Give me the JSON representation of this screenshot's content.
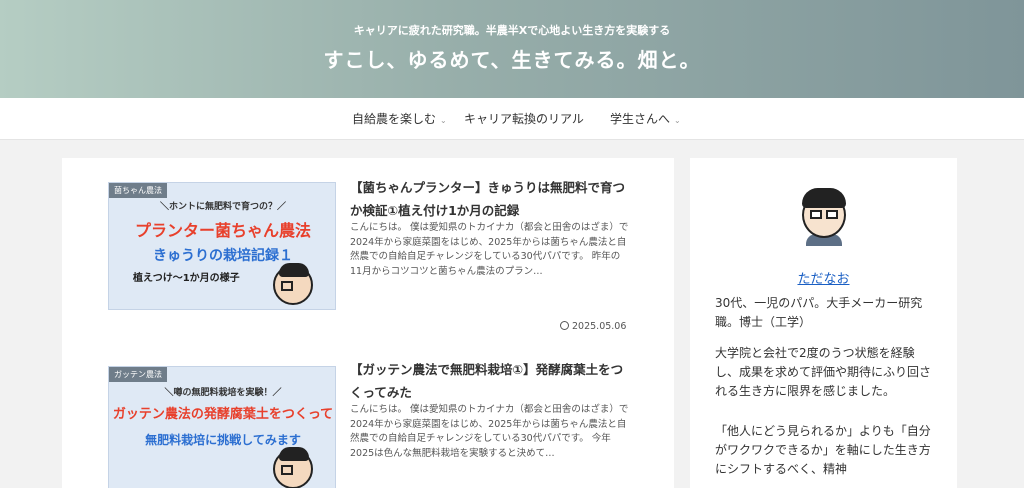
{
  "header": {
    "tagline": "キャリアに疲れた研究職。半農半Xで心地よい生き方を実験する",
    "title": "すこし、ゆるめて、生きてみる。畑と。"
  },
  "nav": {
    "items": [
      {
        "label": "自給農を楽しむ",
        "chevron": "⌄"
      },
      {
        "label": "キャリア転換のリアル",
        "chevron": ""
      },
      {
        "label": "学生さんへ",
        "chevron": "⌄"
      }
    ]
  },
  "posts": [
    {
      "thumb": {
        "category": "菌ちゃん農法",
        "line1": "＼ホントに無肥料で育つの？／",
        "line2": "プランター菌ちゃん農法",
        "line3": "きゅうりの栽培記録１",
        "line4": "植えつけ～1か月の様子"
      },
      "title": "【菌ちゃんプランター】きゅうりは無肥料で育つか検証①植え付け1か月の記録",
      "excerpt": "こんにちは。 僕は愛知県のトカイナカ（都会と田舎のはざま）で2024年から家庭菜園をはじめ、2025年からは菌ちゃん農法と自然農での自給自足チャレンジをしている30代パパです。 昨年の11月からコツコツと菌ちゃん農法のプラン…",
      "date": "2025.05.06"
    },
    {
      "thumb": {
        "category": "ガッテン農法",
        "line1": "＼噂の無肥料栽培を実験！／",
        "line2": "ガッテン農法の発酵腐葉土をつくって",
        "line3": "無肥料栽培に挑戦してみます",
        "line4": ""
      },
      "title": "【ガッテン農法で無肥料栽培①】発酵腐葉土をつくってみた",
      "excerpt": "こんにちは。 僕は愛知県のトカイナカ（都会と田舎のはざま）で2024年から家庭菜園をはじめ、2025年からは菌ちゃん農法と自然農での自給自足チャレンジをしている30代パパです。 今年2025は色んな無肥料栽培を実験すると決めて…",
      "date": ""
    }
  ],
  "sidebar": {
    "name": "ただなお",
    "bio1": "30代、一児のパパ。大手メーカー研究職。博士（工学）",
    "bio2": "大学院と会社で2度のうつ状態を経験し、成果を求めて評価や期待にふり回される生き方に限界を感じました。",
    "bio3": "「他人にどう見られるか」よりも「自分がワクワクできるか」を軸にした生き方にシフトするべく、精神"
  }
}
